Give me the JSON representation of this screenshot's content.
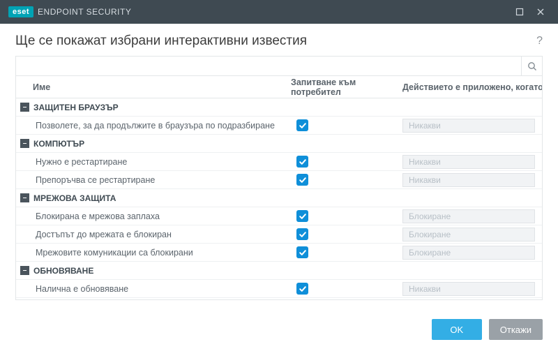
{
  "brand": {
    "badge": "eset",
    "product": "ENDPOINT SECURITY"
  },
  "page_title": "Ще се покажат избрани интерактивни известия",
  "help_glyph": "?",
  "columns": {
    "name": "Име",
    "ask": "Запитване към потребител",
    "action": "Действието е приложено, когато н"
  },
  "collapse_glyph": "–",
  "groups": [
    {
      "label": "ЗАЩИТЕН БРАУЗЪР",
      "items": [
        {
          "name": "Позволете, за да продължите в браузъра по подразбиране",
          "ask": true,
          "action": "Никакви"
        }
      ]
    },
    {
      "label": "КОМПЮТЪР",
      "items": [
        {
          "name": "Нужно е рестартиране",
          "ask": true,
          "action": "Никакви"
        },
        {
          "name": "Препоръчва се рестартиране",
          "ask": true,
          "action": "Никакви"
        }
      ]
    },
    {
      "label": "МРЕЖОВА ЗАЩИТА",
      "items": [
        {
          "name": "Блокирана е мрежова заплаха",
          "ask": true,
          "action": "Блокиране"
        },
        {
          "name": "Достъпът до мрежата е блокиран",
          "ask": true,
          "action": "Блокиране"
        },
        {
          "name": "Мрежовите комуникации са блокирани",
          "ask": true,
          "action": "Блокиране"
        }
      ]
    },
    {
      "label": "ОБНОВЯВАНЕ",
      "items": [
        {
          "name": "Налична е обновяване",
          "ask": true,
          "action": "Никакви"
        }
      ]
    }
  ],
  "buttons": {
    "ok": "OK",
    "cancel": "Откажи"
  }
}
